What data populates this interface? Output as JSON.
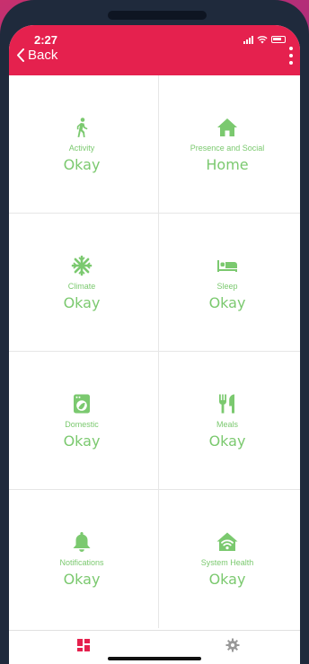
{
  "status": {
    "time": "2:27"
  },
  "nav": {
    "back_label": "Back"
  },
  "colors": {
    "header": "#e5214e",
    "tile_green": "#7bc96f",
    "active_tab": "#e5214e",
    "inactive_tab": "#999999"
  },
  "tiles": [
    {
      "label": "Activity",
      "value": "Okay",
      "icon": "walking-person-icon"
    },
    {
      "label": "Presence and Social",
      "value": "Home",
      "icon": "house-icon"
    },
    {
      "label": "Climate",
      "value": "Okay",
      "icon": "snowflake-icon"
    },
    {
      "label": "Sleep",
      "value": "Okay",
      "icon": "bed-icon"
    },
    {
      "label": "Domestic",
      "value": "Okay",
      "icon": "washing-machine-icon"
    },
    {
      "label": "Meals",
      "value": "Okay",
      "icon": "fork-knife-icon"
    },
    {
      "label": "Notifications",
      "value": "Okay",
      "icon": "bell-icon"
    },
    {
      "label": "System Health",
      "value": "Okay",
      "icon": "wifi-home-icon"
    }
  ],
  "tabs": [
    {
      "name": "dashboard",
      "icon": "dashboard-grid-icon",
      "active": true
    },
    {
      "name": "settings",
      "icon": "gear-icon",
      "active": false
    }
  ]
}
